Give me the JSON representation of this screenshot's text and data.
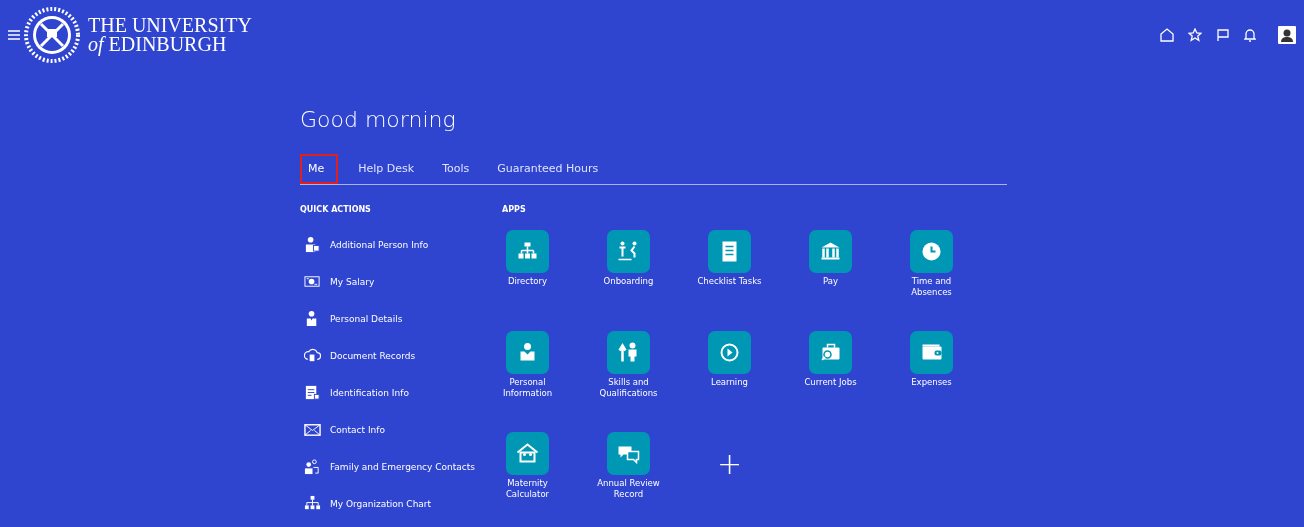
{
  "header": {
    "logo_line1": "THE UNIVERSITY",
    "logo_line2_italic": "of",
    "logo_line2": "EDINBURGH"
  },
  "greeting": "Good morning",
  "tabs": [
    {
      "label": "Me",
      "selected": true
    },
    {
      "label": "Help Desk",
      "selected": false
    },
    {
      "label": "Tools",
      "selected": false
    },
    {
      "label": "Guaranteed Hours",
      "selected": false
    }
  ],
  "quick_actions": {
    "title": "QUICK ACTIONS",
    "items": [
      "Additional Person Info",
      "My Salary",
      "Personal Details",
      "Document Records",
      "Identification Info",
      "Contact Info",
      "Family and Emergency Contacts",
      "My Organization Chart"
    ]
  },
  "apps": {
    "title": "APPS",
    "items": [
      {
        "label": "Directory"
      },
      {
        "label": "Onboarding"
      },
      {
        "label": "Checklist Tasks"
      },
      {
        "label": "Pay"
      },
      {
        "label": "Time and Absences"
      },
      {
        "label": "Personal Information"
      },
      {
        "label": "Skills and Qualifications"
      },
      {
        "label": "Learning"
      },
      {
        "label": "Current Jobs"
      },
      {
        "label": "Expenses"
      },
      {
        "label": "Maternity Calculator"
      },
      {
        "label": "Annual Review Record"
      }
    ],
    "add_button": "+"
  }
}
